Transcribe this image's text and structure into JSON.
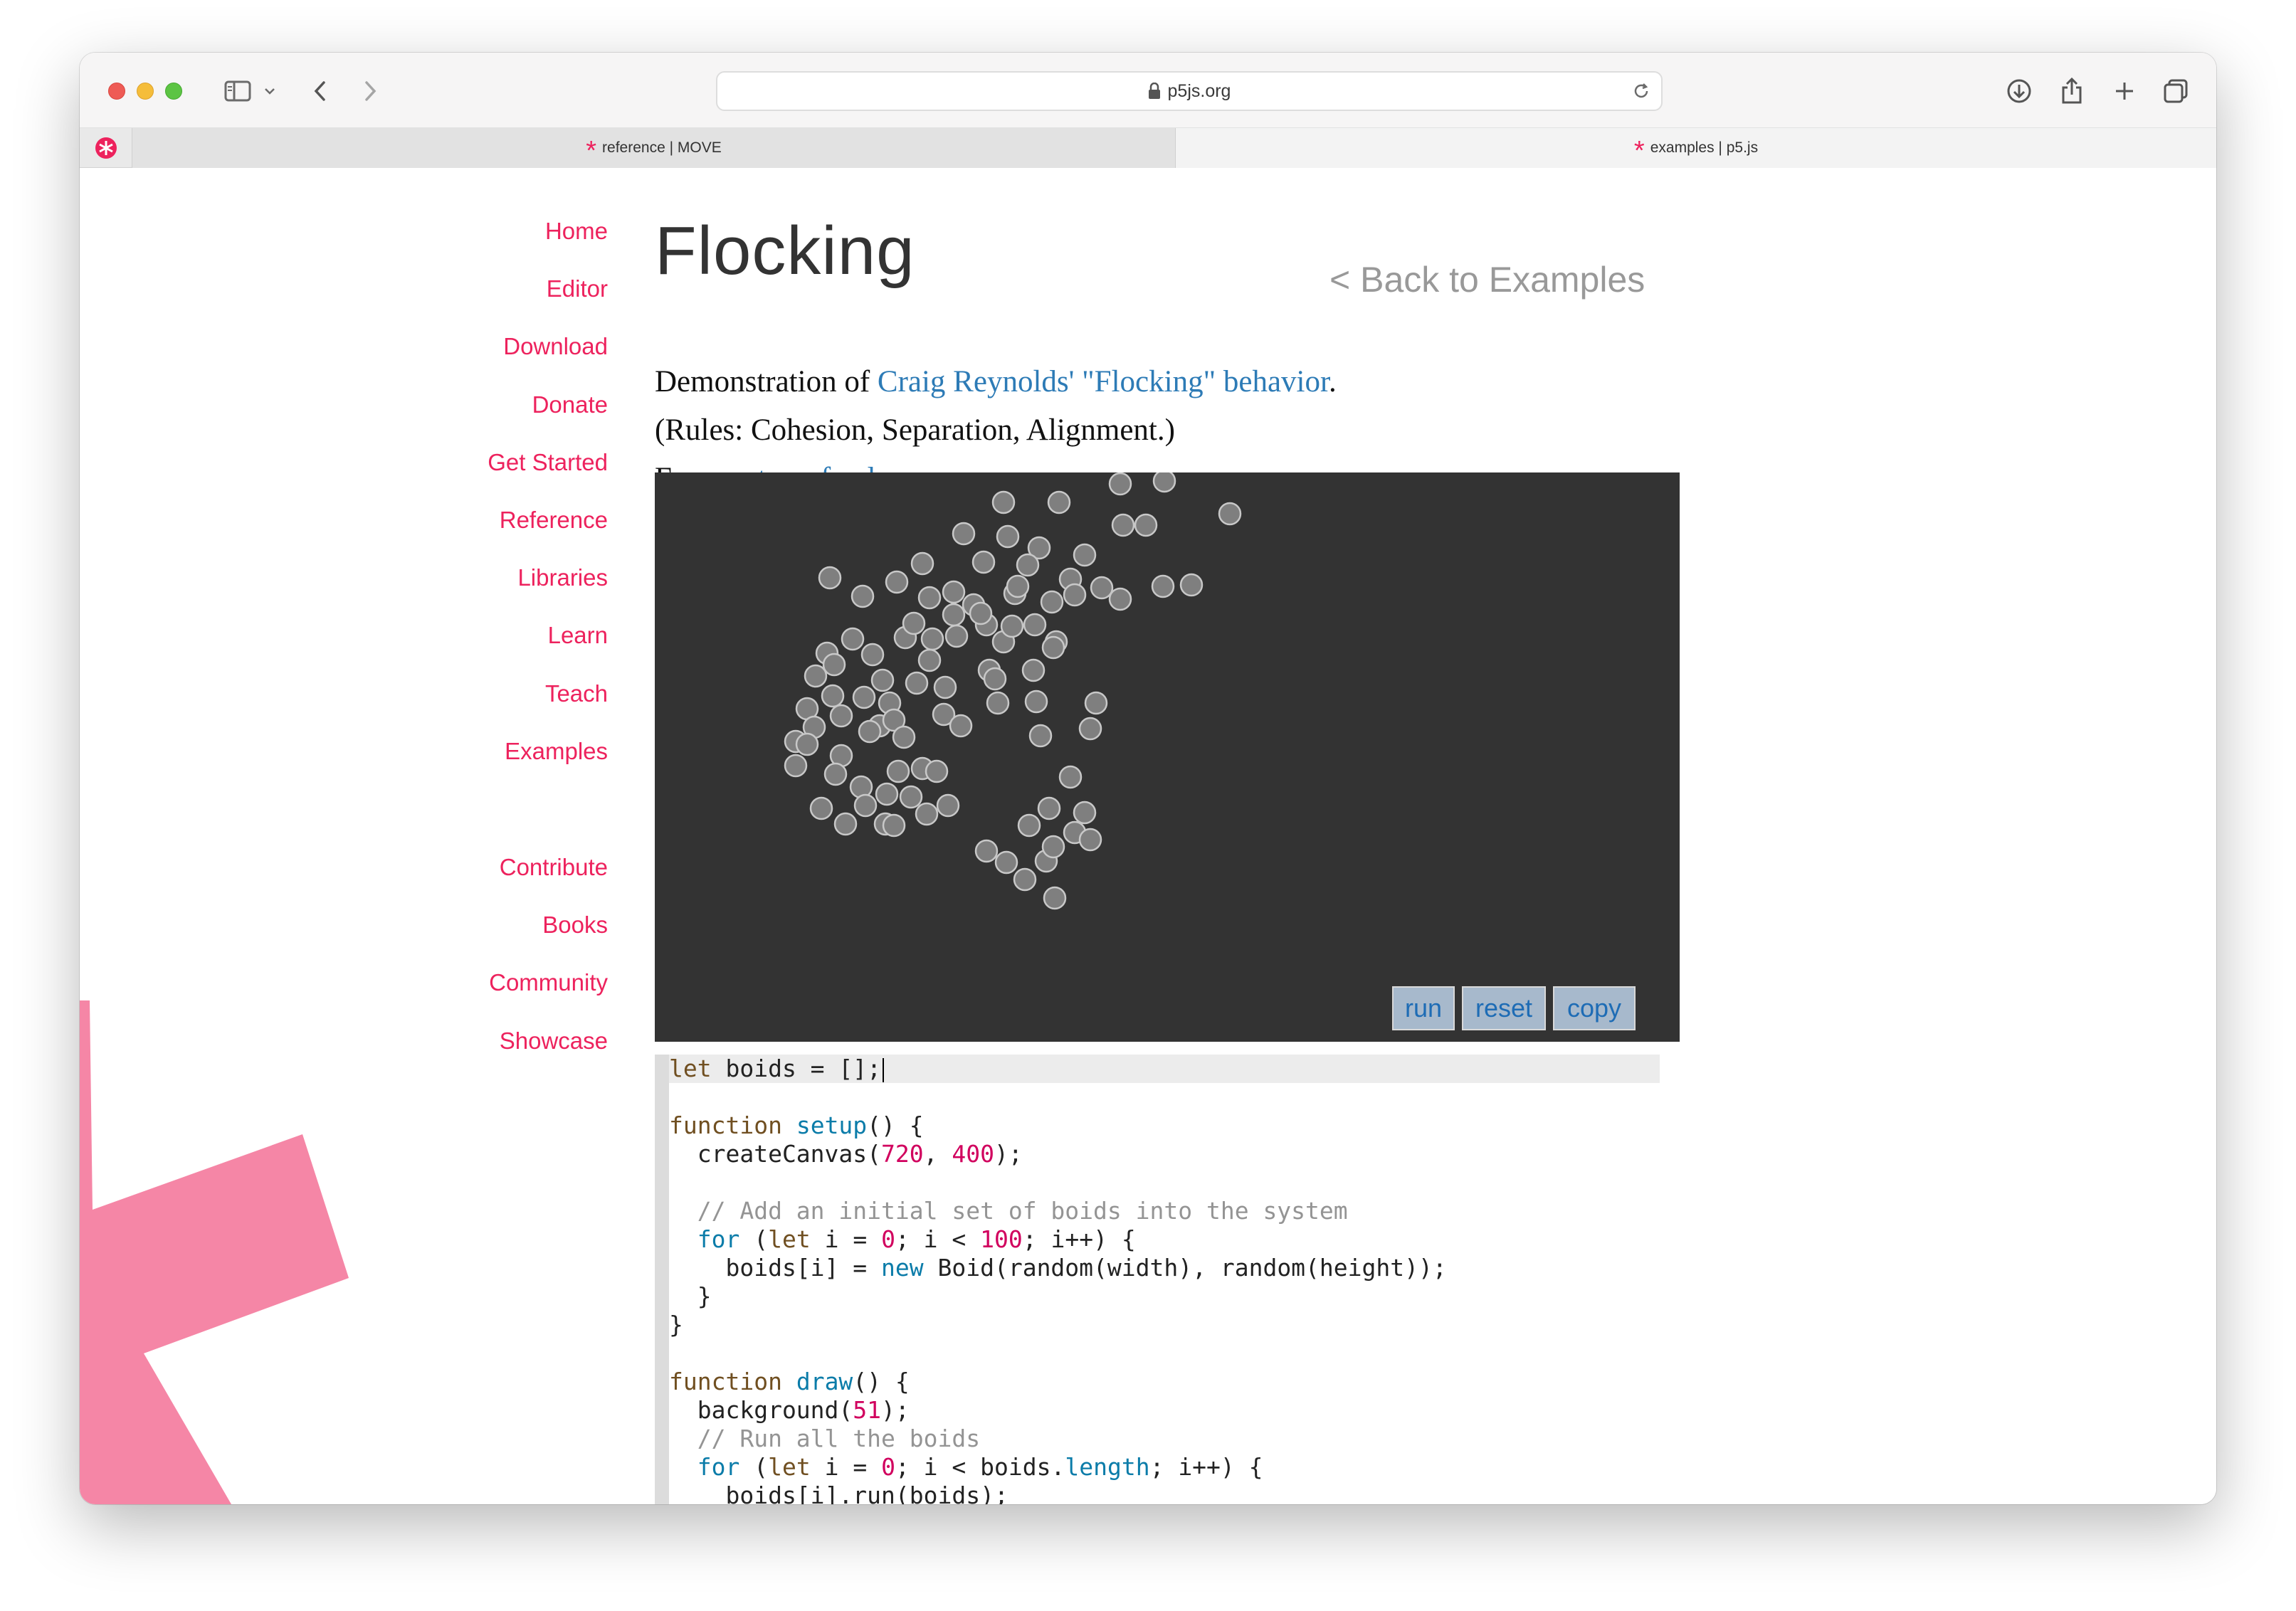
{
  "browser": {
    "url": "p5js.org",
    "tabs": [
      {
        "label": "reference | MOVE"
      },
      {
        "label": "examples | p5.js"
      }
    ]
  },
  "sidebar": {
    "items": [
      {
        "label": "Home"
      },
      {
        "label": "Editor"
      },
      {
        "label": "Download"
      },
      {
        "label": "Donate"
      },
      {
        "label": "Get Started"
      },
      {
        "label": "Reference"
      },
      {
        "label": "Libraries"
      },
      {
        "label": "Learn"
      },
      {
        "label": "Teach"
      },
      {
        "label": "Examples"
      },
      {
        "label": "Contribute"
      },
      {
        "label": "Books"
      },
      {
        "label": "Community"
      },
      {
        "label": "Showcase"
      }
    ]
  },
  "main": {
    "title": "Flocking",
    "back_link": "< Back to Examples",
    "desc_prefix": "Demonstration of ",
    "desc_link": "Craig Reynolds' \"Flocking\" behavior",
    "desc_suffix": ".",
    "rules": "(Rules: Cohesion, Separation, Alignment.)",
    "from_prefix": "From ",
    "from_link": "natureofcode.com",
    "from_suffix": "."
  },
  "sketch": {
    "background": "#333333",
    "buttons": {
      "run": "run",
      "reset": "reset",
      "copy": "copy"
    }
  },
  "code": {
    "l1_a": "let",
    "l1_b": " boids = [];",
    "l3_a": "function",
    "l3_b": " ",
    "l3_c": "setup",
    "l3_d": "() {",
    "l4_a": "  createCanvas(",
    "l4_b": "720",
    "l4_c": ", ",
    "l4_d": "400",
    "l4_e": ");",
    "l6": "  // Add an initial set of boids into the system",
    "l7_a": "  ",
    "l7_b": "for",
    "l7_c": " (",
    "l7_d": "let",
    "l7_e": " i = ",
    "l7_f": "0",
    "l7_g": "; i < ",
    "l7_h": "100",
    "l7_i": "; i++) {",
    "l8_a": "    boids[i] = ",
    "l8_b": "new",
    "l8_c": " Boid(random(width), random(height));",
    "l9": "  }",
    "l10": "}",
    "l12_a": "function",
    "l12_b": " ",
    "l12_c": "draw",
    "l12_d": "() {",
    "l13_a": "  background(",
    "l13_b": "51",
    "l13_c": ");",
    "l14": "  // Run all the boids",
    "l15_a": "  ",
    "l15_b": "for",
    "l15_c": " (",
    "l15_d": "let",
    "l15_e": " i = ",
    "l15_f": "0",
    "l15_g": "; i < boids.",
    "l15_h": "length",
    "l15_i": "; i++) {",
    "l16": "    boids[i].run(boids);"
  },
  "colors": {
    "accent": "#ed225d",
    "link": "#2d7bb6",
    "canvas": "#333333",
    "boid_fill": "#7f7f7f",
    "boid_stroke": "#c8c8c8"
  }
}
